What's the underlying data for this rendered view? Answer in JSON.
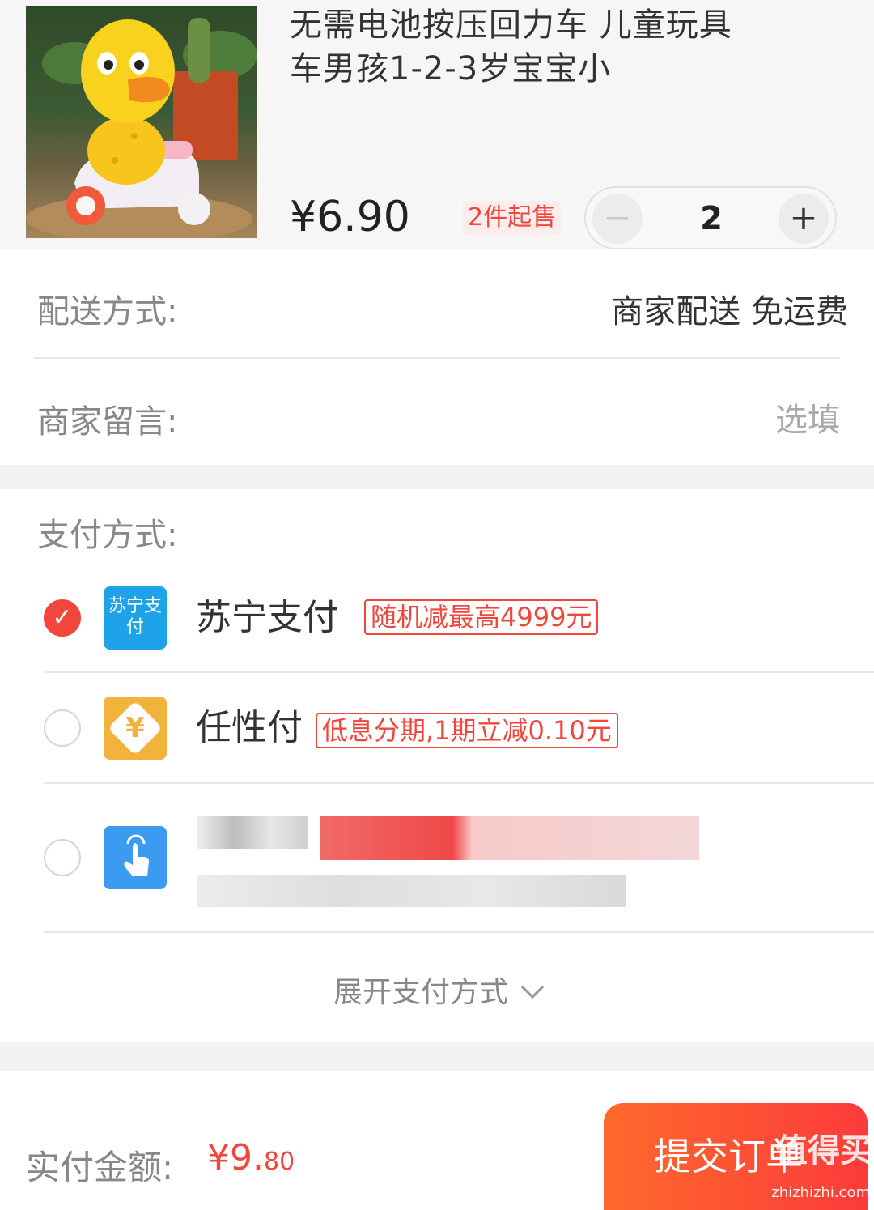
{
  "product": {
    "title": "无需电池按压回力车 儿童玩具车男孩1-2-3岁宝宝小",
    "price": "¥6.90",
    "min_purchase": "2件起售",
    "quantity": "2",
    "minus_label": "−",
    "plus_label": "+"
  },
  "delivery": {
    "label": "配送方式:",
    "value": "商家配送 免运费"
  },
  "message": {
    "label": "商家留言:",
    "placeholder": "选填"
  },
  "payment": {
    "label": "支付方式:",
    "methods": [
      {
        "name": "苏宁支付",
        "icon_text": "苏宁支付",
        "tag": "随机减最高4999元",
        "checked": true,
        "icon": "suning-pay-icon"
      },
      {
        "name": "任性付",
        "icon_text": "¥",
        "tag": "低息分期,1期立减0.10元",
        "checked": false,
        "icon": "renxingfu-icon"
      },
      {
        "name": "",
        "icon": "tap-pay-icon",
        "checked": false
      }
    ],
    "expand_label": "展开支付方式"
  },
  "footer": {
    "total_label": "实付金额:",
    "total_main": "¥9.",
    "total_cents": "80",
    "submit_label": "提交订单"
  },
  "watermark": {
    "text": "值得买",
    "url": "zhizhizhi.com"
  },
  "colors": {
    "accent": "#f0463c",
    "suning_blue": "#1fa3e8",
    "renxing_gold": "#f2b33d",
    "tap_blue": "#3a9bf0"
  }
}
